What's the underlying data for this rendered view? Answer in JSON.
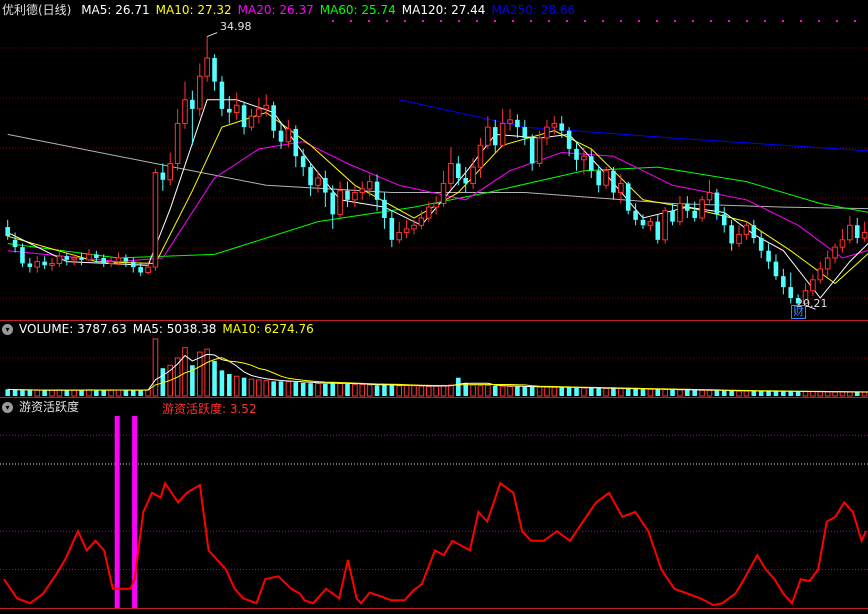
{
  "main_panel": {
    "title": "优利德(日线)",
    "ma_labels": [
      {
        "text": "MA5: 26.71",
        "color": "#ffffff"
      },
      {
        "text": "MA10: 27.32",
        "color": "#ffff00"
      },
      {
        "text": "MA20: 26.37",
        "color": "#ff00ff"
      },
      {
        "text": "MA60: 25.74",
        "color": "#00ff00"
      },
      {
        "text": "MA120: 27.44",
        "color": "#ffffff"
      },
      {
        "text": "MA250: 28.66",
        "color": "#0000ff"
      }
    ],
    "high_label": "34.98",
    "low_label": "20.21",
    "event_badge": "财"
  },
  "volume_panel": {
    "labels": [
      {
        "text": "VOLUME: 3787.63",
        "color": "#ffffff"
      },
      {
        "text": "MA5: 5038.38",
        "color": "#ffffff"
      },
      {
        "text": "MA10: 6274.76",
        "color": "#ffff00"
      }
    ]
  },
  "indicator_panel": {
    "title": "游资活跃度",
    "value_label": "游资活跃度: 3.52"
  },
  "colors": {
    "up": "#ff3232",
    "down": "#54ffff",
    "grid": "#800000",
    "ma5": "#ffffff",
    "ma10": "#ffff00",
    "ma20": "#ff00ff",
    "ma60": "#00ff00",
    "ma120": "#ffffff",
    "ma250": "#0000ff",
    "indicator_line": "#ff0000",
    "spike": "#ff00ff"
  },
  "chart_data": {
    "type": "candlestick",
    "price_range": [
      19.5,
      36.0
    ],
    "candles": [
      [
        24.5,
        24.0,
        24.9,
        23.8
      ],
      [
        23.8,
        23.4,
        24.2,
        23.1
      ],
      [
        23.4,
        22.5,
        23.6,
        22.3
      ],
      [
        22.5,
        22.3,
        22.8,
        22.0
      ],
      [
        22.3,
        22.6,
        22.9,
        22.0
      ],
      [
        22.6,
        22.4,
        22.9,
        22.2
      ],
      [
        22.4,
        22.5,
        22.8,
        22.1
      ],
      [
        22.5,
        22.9,
        23.2,
        22.3
      ],
      [
        22.9,
        22.7,
        23.1,
        22.4
      ],
      [
        22.7,
        22.8,
        23.0,
        22.4
      ],
      [
        22.8,
        22.7,
        23.1,
        22.4
      ],
      [
        22.7,
        23.0,
        23.3,
        22.6
      ],
      [
        23.0,
        22.8,
        23.2,
        22.5
      ],
      [
        22.8,
        22.5,
        23.0,
        22.3
      ],
      [
        22.5,
        22.6,
        22.9,
        22.3
      ],
      [
        22.6,
        22.8,
        23.1,
        22.4
      ],
      [
        22.8,
        22.6,
        23.0,
        22.3
      ],
      [
        22.6,
        22.3,
        22.8,
        22.0
      ],
      [
        22.3,
        22.0,
        22.5,
        21.8
      ],
      [
        22.0,
        22.3,
        22.6,
        21.9
      ],
      [
        22.3,
        27.5,
        27.7,
        22.1
      ],
      [
        27.5,
        27.1,
        28.0,
        26.5
      ],
      [
        27.1,
        28.0,
        28.6,
        26.8
      ],
      [
        28.0,
        30.2,
        31.0,
        27.6
      ],
      [
        30.2,
        31.5,
        32.5,
        29.9
      ],
      [
        31.5,
        31.0,
        32.0,
        29.0
      ],
      [
        31.0,
        32.8,
        33.5,
        30.6
      ],
      [
        32.8,
        33.8,
        34.98,
        32.5
      ],
      [
        33.8,
        32.5,
        34.0,
        32.0
      ],
      [
        32.5,
        31.0,
        32.8,
        30.6
      ],
      [
        31.0,
        30.8,
        31.7,
        30.2
      ],
      [
        30.8,
        31.2,
        31.9,
        30.4
      ],
      [
        31.2,
        30.0,
        31.4,
        29.6
      ],
      [
        30.0,
        30.6,
        31.0,
        29.8
      ],
      [
        30.6,
        31.0,
        31.6,
        30.2
      ],
      [
        31.0,
        31.2,
        31.8,
        30.6
      ],
      [
        31.2,
        29.8,
        31.4,
        29.4
      ],
      [
        29.8,
        29.2,
        30.2,
        28.8
      ],
      [
        29.2,
        29.9,
        30.4,
        28.9
      ],
      [
        29.9,
        28.4,
        30.1,
        27.8
      ],
      [
        28.4,
        27.8,
        28.8,
        27.3
      ],
      [
        27.8,
        26.8,
        28.0,
        26.2
      ],
      [
        26.8,
        27.2,
        27.6,
        26.4
      ],
      [
        27.2,
        26.4,
        27.6,
        25.6
      ],
      [
        26.4,
        25.2,
        26.8,
        24.4
      ],
      [
        25.2,
        26.5,
        27.0,
        25.0
      ],
      [
        26.5,
        26.0,
        27.0,
        25.6
      ],
      [
        26.0,
        26.4,
        26.8,
        25.6
      ],
      [
        26.4,
        26.6,
        27.0,
        26.0
      ],
      [
        26.6,
        27.0,
        27.4,
        26.2
      ],
      [
        27.0,
        26.0,
        27.4,
        25.4
      ],
      [
        26.0,
        25.0,
        26.4,
        24.4
      ],
      [
        25.0,
        23.8,
        25.4,
        23.4
      ],
      [
        23.8,
        24.2,
        24.8,
        23.6
      ],
      [
        24.2,
        24.4,
        24.9,
        23.9
      ],
      [
        24.4,
        24.6,
        24.9,
        24.1
      ],
      [
        24.6,
        25.0,
        25.4,
        24.4
      ],
      [
        25.0,
        25.6,
        25.9,
        24.8
      ],
      [
        25.6,
        25.8,
        26.2,
        25.2
      ],
      [
        25.8,
        26.9,
        27.6,
        25.6
      ],
      [
        26.9,
        28.0,
        28.9,
        26.6
      ],
      [
        28.0,
        27.2,
        28.4,
        26.8
      ],
      [
        27.2,
        26.9,
        27.8,
        26.4
      ],
      [
        26.9,
        27.8,
        28.3,
        26.6
      ],
      [
        27.8,
        29.0,
        29.4,
        27.2
      ],
      [
        29.0,
        30.0,
        30.6,
        28.8
      ],
      [
        30.0,
        29.0,
        30.4,
        28.6
      ],
      [
        29.0,
        30.2,
        31.0,
        28.9
      ],
      [
        30.2,
        30.4,
        31.0,
        29.8
      ],
      [
        30.4,
        30.0,
        30.7,
        29.4
      ],
      [
        30.0,
        29.4,
        30.4,
        29.0
      ],
      [
        29.4,
        28.0,
        29.6,
        27.6
      ],
      [
        28.0,
        29.4,
        29.8,
        27.8
      ],
      [
        29.4,
        30.0,
        30.4,
        29.0
      ],
      [
        30.0,
        30.2,
        30.6,
        29.6
      ],
      [
        30.2,
        29.8,
        30.6,
        29.4
      ],
      [
        29.8,
        28.8,
        30.0,
        28.4
      ],
      [
        28.8,
        28.2,
        29.2,
        27.6
      ],
      [
        28.2,
        28.4,
        28.9,
        27.4
      ],
      [
        28.4,
        27.6,
        28.8,
        27.2
      ],
      [
        27.6,
        26.8,
        27.9,
        26.4
      ],
      [
        26.8,
        27.6,
        27.8,
        26.6
      ],
      [
        27.6,
        26.4,
        27.8,
        26.0
      ],
      [
        26.4,
        26.9,
        27.4,
        25.8
      ],
      [
        26.9,
        25.4,
        27.0,
        25.2
      ],
      [
        25.4,
        24.9,
        25.8,
        24.6
      ],
      [
        24.9,
        24.6,
        25.2,
        24.4
      ],
      [
        24.6,
        24.8,
        25.0,
        24.3
      ],
      [
        24.8,
        23.8,
        25.2,
        23.6
      ],
      [
        23.8,
        25.4,
        25.6,
        23.6
      ],
      [
        25.4,
        24.8,
        25.8,
        24.6
      ],
      [
        24.8,
        25.8,
        26.2,
        24.6
      ],
      [
        25.8,
        25.4,
        26.2,
        25.0
      ],
      [
        25.4,
        25.0,
        25.9,
        24.8
      ],
      [
        25.0,
        26.0,
        26.2,
        24.8
      ],
      [
        26.0,
        26.4,
        27.1,
        25.8
      ],
      [
        26.4,
        25.2,
        26.6,
        24.9
      ],
      [
        25.2,
        24.6,
        25.6,
        24.2
      ],
      [
        24.6,
        23.6,
        24.9,
        23.2
      ],
      [
        23.6,
        24.1,
        24.6,
        23.4
      ],
      [
        24.1,
        24.6,
        24.8,
        23.8
      ],
      [
        24.6,
        23.9,
        24.9,
        23.6
      ],
      [
        23.9,
        23.2,
        24.3,
        22.8
      ],
      [
        23.2,
        22.6,
        23.6,
        22.2
      ],
      [
        22.6,
        21.8,
        23.0,
        21.6
      ],
      [
        21.8,
        21.2,
        22.2,
        20.8
      ],
      [
        21.2,
        20.6,
        22.0,
        20.3
      ],
      [
        20.6,
        20.3,
        20.8,
        20.21
      ],
      [
        20.3,
        21.0,
        21.4,
        20.2
      ],
      [
        21.0,
        21.6,
        21.9,
        20.7
      ],
      [
        21.6,
        22.2,
        22.6,
        21.4
      ],
      [
        22.2,
        22.8,
        23.2,
        21.8
      ],
      [
        22.8,
        23.4,
        23.6,
        22.5
      ],
      [
        23.4,
        23.8,
        24.4,
        23.1
      ],
      [
        23.8,
        24.6,
        25.1,
        23.6
      ],
      [
        24.6,
        23.9,
        25.0,
        23.6
      ],
      [
        23.9,
        24.2,
        24.8,
        23.7
      ]
    ],
    "ma5_curve": [
      [
        0,
        24.2
      ],
      [
        8,
        22.6
      ],
      [
        19,
        22.4
      ],
      [
        22,
        25.5
      ],
      [
        27,
        31.5
      ],
      [
        31,
        31.5
      ],
      [
        36,
        30.8
      ],
      [
        41,
        28.0
      ],
      [
        45,
        26.0
      ],
      [
        51,
        25.6
      ],
      [
        56,
        24.6
      ],
      [
        62,
        27.5
      ],
      [
        66,
        29.6
      ],
      [
        72,
        29.4
      ],
      [
        76,
        29.6
      ],
      [
        81,
        27.4
      ],
      [
        86,
        25.0
      ],
      [
        92,
        25.6
      ],
      [
        97,
        25.3
      ],
      [
        101,
        24.1
      ],
      [
        105,
        23.2
      ],
      [
        110,
        20.6
      ],
      [
        114,
        22.6
      ],
      [
        118,
        24.2
      ]
    ],
    "ma10_curve": [
      [
        0,
        24.0
      ],
      [
        12,
        22.6
      ],
      [
        20,
        22.5
      ],
      [
        25,
        26.5
      ],
      [
        29,
        30.0
      ],
      [
        35,
        30.8
      ],
      [
        41,
        29.0
      ],
      [
        47,
        26.8
      ],
      [
        55,
        25.0
      ],
      [
        61,
        26.4
      ],
      [
        67,
        29.0
      ],
      [
        74,
        29.8
      ],
      [
        79,
        28.8
      ],
      [
        86,
        26.0
      ],
      [
        93,
        25.5
      ],
      [
        100,
        24.8
      ],
      [
        106,
        23.2
      ],
      [
        112,
        21.4
      ],
      [
        118,
        23.6
      ]
    ],
    "ma20_curve": [
      [
        0,
        23.2
      ],
      [
        15,
        22.6
      ],
      [
        21,
        22.8
      ],
      [
        28,
        27.2
      ],
      [
        34,
        28.8
      ],
      [
        40,
        29.2
      ],
      [
        46,
        28.0
      ],
      [
        53,
        26.8
      ],
      [
        62,
        26.0
      ],
      [
        68,
        27.6
      ],
      [
        75,
        28.6
      ],
      [
        82,
        28.4
      ],
      [
        90,
        26.8
      ],
      [
        100,
        26.0
      ],
      [
        107,
        24.6
      ],
      [
        113,
        22.8
      ],
      [
        118,
        23.4
      ]
    ],
    "ma60_curve": [
      [
        0,
        23.6
      ],
      [
        15,
        22.8
      ],
      [
        28,
        23.0
      ],
      [
        42,
        24.8
      ],
      [
        55,
        25.6
      ],
      [
        65,
        26.4
      ],
      [
        78,
        27.6
      ],
      [
        88,
        27.8
      ],
      [
        100,
        27.0
      ],
      [
        110,
        25.8
      ],
      [
        118,
        25.2
      ]
    ],
    "ma120_curve": [
      [
        0,
        29.6
      ],
      [
        20,
        28.0
      ],
      [
        35,
        26.8
      ],
      [
        52,
        26.4
      ],
      [
        70,
        26.4
      ],
      [
        90,
        25.8
      ],
      [
        105,
        25.6
      ],
      [
        118,
        25.5
      ]
    ],
    "ma250_curve": [
      [
        53,
        31.5
      ],
      [
        70,
        30.0
      ],
      [
        90,
        29.4
      ],
      [
        118,
        28.66
      ]
    ],
    "volume": [
      900,
      850,
      800,
      780,
      760,
      790,
      800,
      830,
      810,
      800,
      820,
      850,
      830,
      800,
      790,
      810,
      820,
      800,
      780,
      850,
      7800,
      3800,
      4200,
      5200,
      6600,
      4200,
      6000,
      6400,
      4800,
      3500,
      3000,
      2700,
      2500,
      2300,
      2200,
      2100,
      2000,
      2000,
      1950,
      1900,
      1800,
      1750,
      1700,
      1650,
      1900,
      1700,
      1650,
      1600,
      1550,
      1500,
      1450,
      1600,
      1500,
      1400,
      1450,
      1400,
      1350,
      1300,
      1350,
      1450,
      1500,
      2500,
      1800,
      1500,
      1400,
      1450,
      1400,
      1350,
      1300,
      1280,
      1250,
      1240,
      1230,
      1220,
      1200,
      1180,
      1150,
      1120,
      1100,
      1080,
      1060,
      1040,
      1020,
      1000,
      980,
      960,
      940,
      920,
      900,
      880,
      860,
      840,
      820,
      800,
      780,
      760,
      740,
      720,
      700,
      690,
      680,
      670,
      660,
      650,
      640,
      630,
      620,
      610,
      600,
      590,
      580,
      570,
      560,
      550,
      540,
      530,
      520,
      510,
      500,
      490
    ],
    "volume_range": [
      0,
      8200
    ],
    "indicator": {
      "name": "游资活跃度",
      "range": [
        0,
        20
      ],
      "curve": [
        [
          0,
          3
        ],
        [
          3,
          1
        ],
        [
          6,
          0.5
        ],
        [
          9,
          1.5
        ],
        [
          12,
          3.5
        ],
        [
          14,
          5
        ],
        [
          17,
          8
        ],
        [
          19,
          6
        ],
        [
          21,
          7
        ],
        [
          23,
          6
        ],
        [
          25,
          2
        ],
        [
          27,
          2
        ],
        [
          29,
          2
        ],
        [
          30,
          3
        ],
        [
          32,
          10
        ],
        [
          34,
          12
        ],
        [
          36,
          11.5
        ],
        [
          37,
          13
        ],
        [
          40,
          11
        ],
        [
          42,
          12
        ],
        [
          45,
          12.8
        ],
        [
          47,
          6
        ],
        [
          49,
          5
        ],
        [
          51,
          4
        ],
        [
          53,
          2
        ],
        [
          55,
          1
        ],
        [
          58,
          0.5
        ],
        [
          60,
          3
        ],
        [
          63,
          3.3
        ],
        [
          66,
          2
        ],
        [
          68,
          1.5
        ],
        [
          69,
          0.8
        ],
        [
          71,
          0.5
        ],
        [
          74,
          2
        ],
        [
          77,
          1
        ],
        [
          79,
          5
        ],
        [
          81,
          1
        ],
        [
          82,
          0.5
        ],
        [
          84,
          1.6
        ],
        [
          86,
          1.3
        ],
        [
          89,
          0.8
        ],
        [
          92,
          0.8
        ],
        [
          94,
          1.8
        ],
        [
          96,
          2.5
        ],
        [
          99,
          6
        ],
        [
          101,
          5.5
        ],
        [
          103,
          7
        ],
        [
          107,
          6
        ],
        [
          109,
          10
        ],
        [
          111,
          9
        ],
        [
          114,
          13
        ],
        [
          117,
          12
        ],
        [
          119,
          8
        ],
        [
          121,
          7
        ],
        [
          124,
          7
        ],
        [
          127,
          8
        ],
        [
          130,
          7
        ],
        [
          133,
          9
        ],
        [
          136,
          11
        ],
        [
          139,
          12
        ],
        [
          142,
          9.5
        ],
        [
          145,
          10
        ],
        [
          148,
          8
        ],
        [
          151,
          4
        ],
        [
          154,
          2
        ],
        [
          157,
          1.5
        ],
        [
          160,
          1
        ],
        [
          163,
          0.3
        ],
        [
          165,
          0.5
        ],
        [
          168,
          1.5
        ],
        [
          170,
          3
        ],
        [
          173,
          5.5
        ],
        [
          175,
          4
        ],
        [
          177,
          3
        ],
        [
          179,
          1.5
        ],
        [
          181,
          0.5
        ],
        [
          183,
          3
        ],
        [
          185,
          2.8
        ],
        [
          187,
          4
        ],
        [
          189,
          9
        ],
        [
          191,
          9.5
        ],
        [
          193,
          11
        ],
        [
          195,
          10
        ],
        [
          197,
          7
        ],
        [
          198,
          8
        ]
      ],
      "spikes": [
        26,
        30
      ]
    }
  }
}
